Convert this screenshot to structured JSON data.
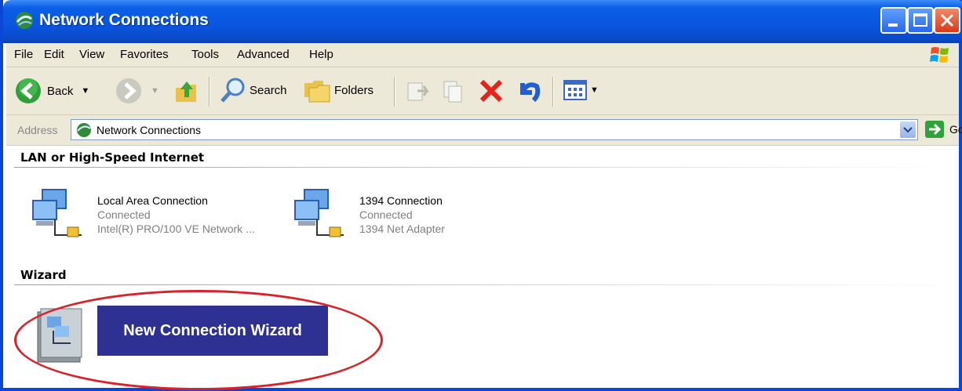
{
  "window": {
    "title": "Network Connections"
  },
  "menu": [
    "File",
    "Edit",
    "View",
    "Favorites",
    "Tools",
    "Advanced",
    "Help"
  ],
  "toolbar": {
    "back_label": "Back",
    "search_label": "Search",
    "folders_label": "Folders"
  },
  "address": {
    "label": "Address",
    "value": "Network Connections",
    "go_label": "Go"
  },
  "groups": {
    "lan": {
      "heading": "LAN or High-Speed Internet",
      "items": [
        {
          "name": "Local Area Connection",
          "status": "Connected",
          "device": "Intel(R) PRO/100 VE Network ..."
        },
        {
          "name": "1394 Connection",
          "status": "Connected",
          "device": "1394 Net Adapter"
        }
      ]
    },
    "wizard": {
      "heading": "Wizard",
      "button_label": "New Connection Wizard"
    }
  },
  "colors": {
    "titlebar": "#0a55df",
    "wizard_button": "#2e3192",
    "highlight": "#d9232a",
    "chrome": "#ece9d8"
  }
}
